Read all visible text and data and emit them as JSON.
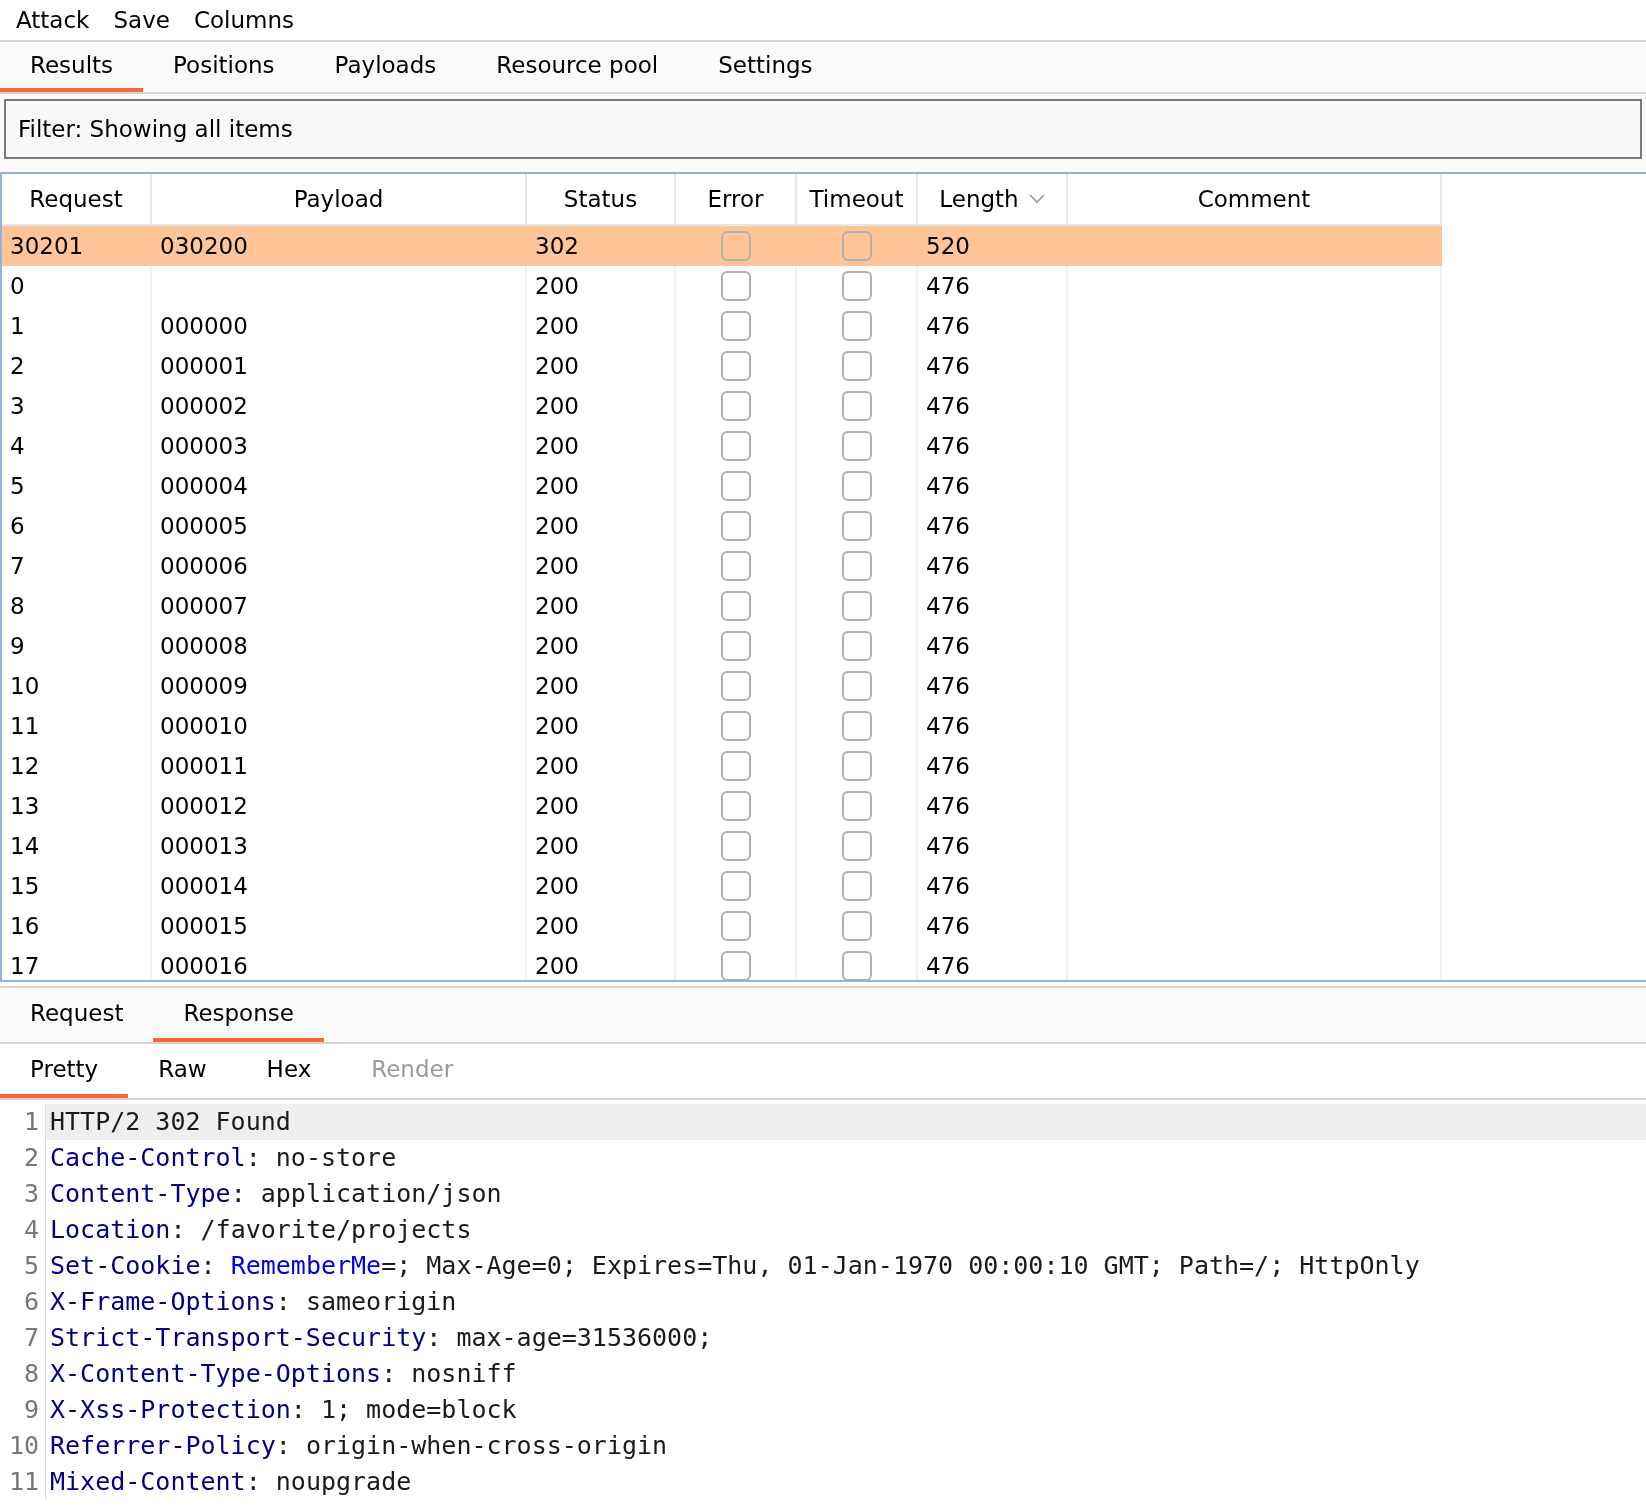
{
  "menu": [
    "Attack",
    "Save",
    "Columns"
  ],
  "tabs": [
    {
      "label": "Results",
      "selected": true
    },
    {
      "label": "Positions",
      "selected": false
    },
    {
      "label": "Payloads",
      "selected": false
    },
    {
      "label": "Resource pool",
      "selected": false
    },
    {
      "label": "Settings",
      "selected": false
    }
  ],
  "filter": "Filter: Showing all items",
  "table": {
    "columns": [
      {
        "label": "Request"
      },
      {
        "label": "Payload"
      },
      {
        "label": "Status"
      },
      {
        "label": "Error"
      },
      {
        "label": "Timeout"
      },
      {
        "label": "Length",
        "sorted": true
      },
      {
        "label": "Comment"
      }
    ],
    "rows": [
      {
        "request": "30201",
        "payload": "030200",
        "status": "302",
        "error": false,
        "timeout": false,
        "length": "520",
        "selected": true
      },
      {
        "request": "0",
        "status": "200",
        "error": false,
        "timeout": false,
        "length": "476",
        "selected": false
      },
      {
        "request": "1",
        "payload": "000000",
        "status": "200",
        "error": false,
        "timeout": false,
        "length": "476",
        "selected": false
      },
      {
        "request": "2",
        "payload": "000001",
        "status": "200",
        "error": false,
        "timeout": false,
        "length": "476",
        "selected": false
      },
      {
        "request": "3",
        "payload": "000002",
        "status": "200",
        "error": false,
        "timeout": false,
        "length": "476",
        "selected": false
      },
      {
        "request": "4",
        "payload": "000003",
        "status": "200",
        "error": false,
        "timeout": false,
        "length": "476",
        "selected": false
      },
      {
        "request": "5",
        "payload": "000004",
        "status": "200",
        "error": false,
        "timeout": false,
        "length": "476",
        "selected": false
      },
      {
        "request": "6",
        "payload": "000005",
        "status": "200",
        "error": false,
        "timeout": false,
        "length": "476",
        "selected": false
      },
      {
        "request": "7",
        "payload": "000006",
        "status": "200",
        "error": false,
        "timeout": false,
        "length": "476",
        "selected": false
      },
      {
        "request": "8",
        "payload": "000007",
        "status": "200",
        "error": false,
        "timeout": false,
        "length": "476",
        "selected": false
      },
      {
        "request": "9",
        "payload": "000008",
        "status": "200",
        "error": false,
        "timeout": false,
        "length": "476",
        "selected": false
      },
      {
        "request": "10",
        "payload": "000009",
        "status": "200",
        "error": false,
        "timeout": false,
        "length": "476",
        "selected": false
      },
      {
        "request": "11",
        "payload": "000010",
        "status": "200",
        "error": false,
        "timeout": false,
        "length": "476",
        "selected": false
      },
      {
        "request": "12",
        "payload": "000011",
        "status": "200",
        "error": false,
        "timeout": false,
        "length": "476",
        "selected": false
      },
      {
        "request": "13",
        "payload": "000012",
        "status": "200",
        "error": false,
        "timeout": false,
        "length": "476",
        "selected": false
      },
      {
        "request": "14",
        "payload": "000013",
        "status": "200",
        "error": false,
        "timeout": false,
        "length": "476",
        "selected": false
      },
      {
        "request": "15",
        "payload": "000014",
        "status": "200",
        "error": false,
        "timeout": false,
        "length": "476",
        "selected": false
      },
      {
        "request": "16",
        "payload": "000015",
        "status": "200",
        "error": false,
        "timeout": false,
        "length": "476",
        "selected": false
      },
      {
        "request": "17",
        "payload": "000016",
        "status": "200",
        "error": false,
        "timeout": false,
        "length": "476",
        "selected": false
      }
    ]
  },
  "message_tabs": [
    {
      "label": "Request",
      "selected": false
    },
    {
      "label": "Response",
      "selected": true
    }
  ],
  "view_tabs": [
    {
      "label": "Pretty",
      "selected": true,
      "disabled": false
    },
    {
      "label": "Raw",
      "selected": false,
      "disabled": false
    },
    {
      "label": "Hex",
      "selected": false,
      "disabled": false
    },
    {
      "label": "Render",
      "selected": false,
      "disabled": true
    }
  ],
  "response_lines": [
    {
      "number": "1",
      "highlighted": true,
      "segments": [
        {
          "kind": "plain",
          "text": "HTTP/2 302 Found"
        }
      ]
    },
    {
      "number": "2",
      "highlighted": false,
      "segments": [
        {
          "kind": "header",
          "text": "Cache-Control"
        },
        {
          "kind": "plain",
          "text": ": no-store"
        }
      ]
    },
    {
      "number": "3",
      "highlighted": false,
      "segments": [
        {
          "kind": "header",
          "text": "Content-Type"
        },
        {
          "kind": "plain",
          "text": ": application/json"
        }
      ]
    },
    {
      "number": "4",
      "highlighted": false,
      "segments": [
        {
          "kind": "header",
          "text": "Location"
        },
        {
          "kind": "plain",
          "text": ": /favorite/projects"
        }
      ]
    },
    {
      "number": "5",
      "highlighted": false,
      "segments": [
        {
          "kind": "header",
          "text": "Set-Cookie"
        },
        {
          "kind": "plain",
          "text": ": "
        },
        {
          "kind": "cookie",
          "text": "RememberMe"
        },
        {
          "kind": "plain",
          "text": "=; Max-Age=0; Expires=Thu, 01-Jan-1970 00:00:10 GMT; Path=/; HttpOnly"
        }
      ]
    },
    {
      "number": "6",
      "highlighted": false,
      "segments": [
        {
          "kind": "header",
          "text": "X-Frame-Options"
        },
        {
          "kind": "plain",
          "text": ": sameorigin"
        }
      ]
    },
    {
      "number": "7",
      "highlighted": false,
      "segments": [
        {
          "kind": "header",
          "text": "Strict-Transport-Security"
        },
        {
          "kind": "plain",
          "text": ": max-age=31536000;"
        }
      ]
    },
    {
      "number": "8",
      "highlighted": false,
      "segments": [
        {
          "kind": "header",
          "text": "X-Content-Type-Options"
        },
        {
          "kind": "plain",
          "text": ": nosniff"
        }
      ]
    },
    {
      "number": "9",
      "highlighted": false,
      "segments": [
        {
          "kind": "header",
          "text": "X-Xss-Protection"
        },
        {
          "kind": "plain",
          "text": ": 1; mode=block"
        }
      ]
    },
    {
      "number": "10",
      "highlighted": false,
      "segments": [
        {
          "kind": "header",
          "text": "Referrer-Policy"
        },
        {
          "kind": "plain",
          "text": ": origin-when-cross-origin"
        }
      ]
    },
    {
      "number": "11",
      "highlighted": false,
      "segments": [
        {
          "kind": "header",
          "text": "Mixed-Content"
        },
        {
          "kind": "plain",
          "text": ": noupgrade"
        }
      ]
    }
  ]
}
